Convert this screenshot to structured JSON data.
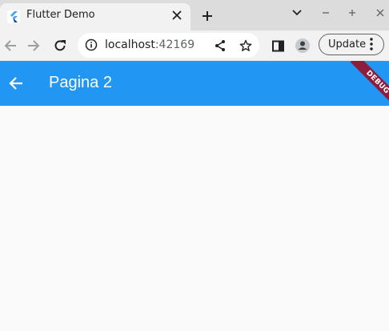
{
  "browser": {
    "tab": {
      "title": "Flutter Demo",
      "favicon": "flutter-logo"
    },
    "address": {
      "host": "localhost",
      "port": ":42169"
    },
    "update_label": "Update",
    "icons": [
      "back-arrow-icon",
      "forward-arrow-icon",
      "reload-icon",
      "info-icon",
      "share-icon",
      "star-icon",
      "side-panel-icon",
      "profile-icon",
      "kebab-menu-icon",
      "close-icon",
      "plus-icon",
      "chevron-down-icon",
      "minimize-icon",
      "maximize-icon"
    ]
  },
  "app": {
    "title": "Pagina 2",
    "debug_banner": "DEBUG",
    "colors": {
      "appbar": "#2196f3",
      "banner": "#8e1d3c",
      "background": "#fafafa"
    }
  }
}
